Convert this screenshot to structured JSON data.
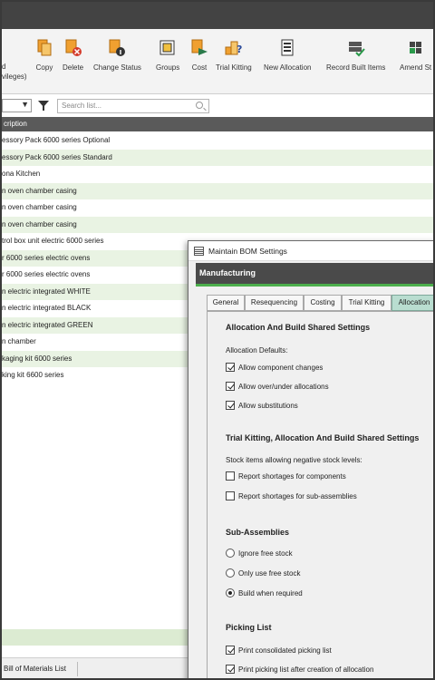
{
  "ribbon": {
    "partial_label_lines": [
      "d",
      "vileges)"
    ],
    "buttons": [
      {
        "label": "Copy",
        "icon": "copy-icon"
      },
      {
        "label": "Delete",
        "icon": "delete-icon"
      },
      {
        "label": "Change Status",
        "icon": "change-status-icon"
      },
      {
        "label": "Groups",
        "icon": "groups-icon"
      },
      {
        "label": "Cost",
        "icon": "cost-icon"
      },
      {
        "label": "Trial Kitting",
        "icon": "trial-kitting-icon"
      },
      {
        "label": "New Allocation",
        "icon": "new-allocation-icon"
      },
      {
        "label": "Record Built Items",
        "icon": "record-built-items-icon"
      },
      {
        "label": "Amend St",
        "icon": "amend-icon"
      }
    ]
  },
  "filter": {
    "search_placeholder": "Search list..."
  },
  "list": {
    "column_header": "cription",
    "rows": [
      "essory Pack 6000 series Optional",
      "essory Pack 6000 series Standard",
      "ona Kitchen",
      "n oven chamber casing",
      "n oven chamber casing",
      "n oven chamber casing",
      "trol box unit electric 6000 series",
      "r 6000 series electric ovens",
      "r 6000 series electric ovens",
      "n electric integrated WHITE",
      "n electric integrated BLACK",
      "n electric integrated GREEN",
      "n chamber",
      "kaging kit 6000 series",
      "king kit 6600 series"
    ]
  },
  "statusbar": {
    "tab_label": "Bill of Materials List"
  },
  "dialog": {
    "title": "Maintain BOM Settings",
    "section": "Manufacturing",
    "tabs": [
      "General",
      "Resequencing",
      "Costing",
      "Trial Kitting",
      "Allocation"
    ],
    "active_tab": "Allocation",
    "alloc_heading": "Allocation And Build Shared Settings",
    "alloc_defaults_label": "Allocation Defaults:",
    "alloc_options": [
      {
        "label": "Allow component changes",
        "checked": true
      },
      {
        "label": "Allow over/under allocations",
        "checked": true
      },
      {
        "label": "Allow substitutions",
        "checked": true
      }
    ],
    "trial_heading": "Trial Kitting, Allocation And Build Shared Settings",
    "neg_stock_label": "Stock items allowing negative stock levels:",
    "neg_options": [
      {
        "label": "Report shortages for components",
        "checked": false
      },
      {
        "label": "Report shortages for sub-assemblies",
        "checked": false
      }
    ],
    "sub_heading": "Sub-Assemblies",
    "sub_options": [
      {
        "label": "Ignore free stock",
        "checked": false
      },
      {
        "label": "Only use free stock",
        "checked": false
      },
      {
        "label": "Build when required",
        "checked": true
      }
    ],
    "picking_heading": "Picking List",
    "picking_options": [
      {
        "label": "Print consolidated picking list",
        "checked": true
      },
      {
        "label": "Print picking list after creation of allocation",
        "checked": true
      }
    ]
  },
  "colors": {
    "accent_green": "#4cae4c",
    "active_tab": "#b9ddd0",
    "row_alt": "#e9f3e3",
    "header_bg": "#5a5a5a"
  }
}
